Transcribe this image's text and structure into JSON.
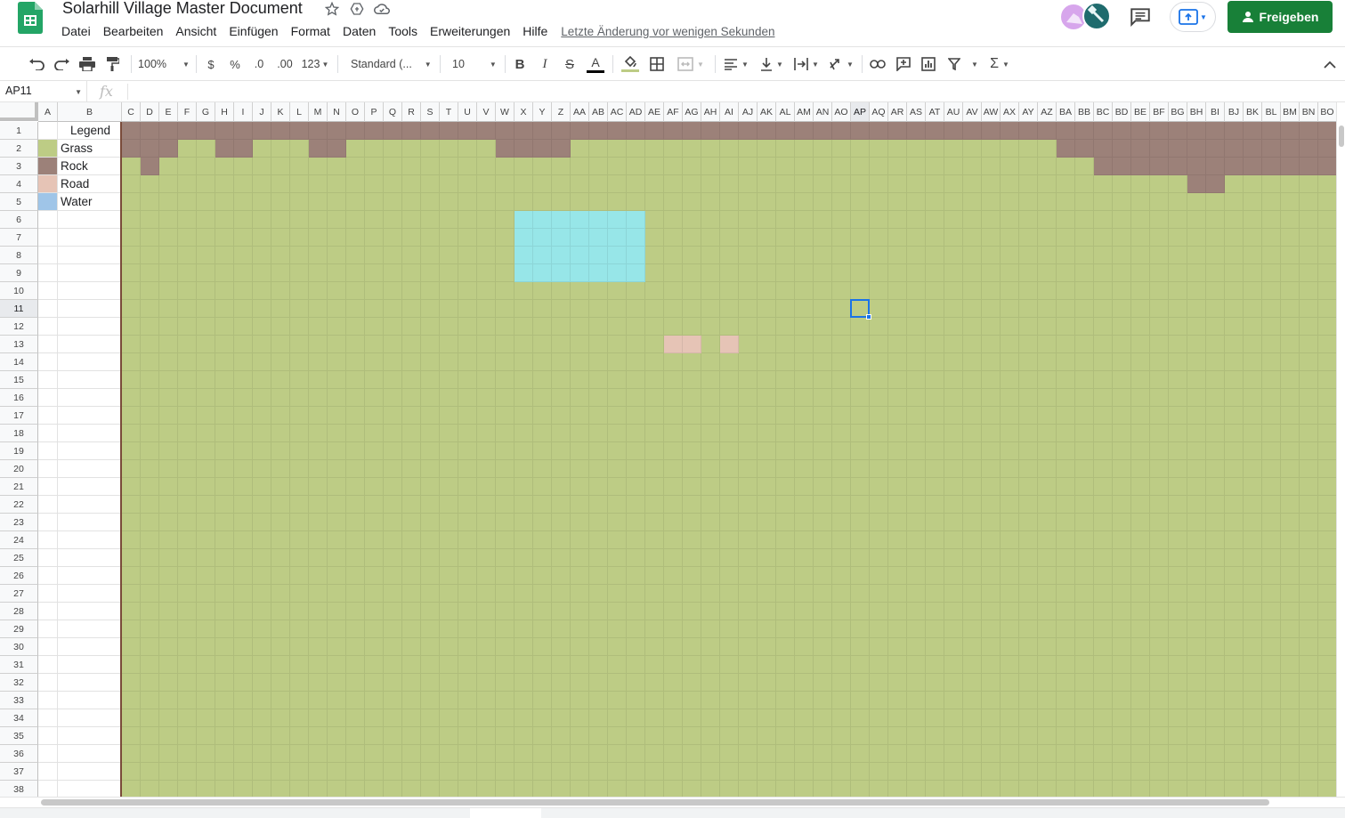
{
  "app": {
    "title": "Solarhill Village Master Document",
    "menu": [
      "Datei",
      "Bearbeiten",
      "Ansicht",
      "Einfügen",
      "Format",
      "Daten",
      "Tools",
      "Erweiterungen",
      "Hilfe"
    ],
    "last_edit": "Letzte Änderung vor wenigen Sekunden",
    "share_label": "Freigeben",
    "brand_color": "#188038"
  },
  "toolbar": {
    "zoom": "100%",
    "currency": "$",
    "percent": "%",
    "decimal_decrease": ".0",
    "decimal_increase": ".00",
    "more_formats": "123",
    "font": "Standard (...",
    "font_size": "10"
  },
  "formula_bar": {
    "name_box": "AP11",
    "fx": "fx",
    "value": ""
  },
  "sheet": {
    "columns": [
      "A",
      "B",
      "C",
      "D",
      "E",
      "F",
      "G",
      "H",
      "I",
      "J",
      "K",
      "L",
      "M",
      "N",
      "O",
      "P",
      "Q",
      "R",
      "S",
      "T",
      "U",
      "V",
      "W",
      "X",
      "Y",
      "Z",
      "AA",
      "AB",
      "AC",
      "AD",
      "AE",
      "AF",
      "AG",
      "AH",
      "AI",
      "AJ",
      "AK",
      "AL",
      "AM",
      "AN",
      "AO",
      "AP",
      "AQ",
      "AR",
      "AS",
      "AT",
      "AU",
      "AV",
      "AW",
      "AX",
      "AY",
      "AZ",
      "BA",
      "BB",
      "BC",
      "BD",
      "BE",
      "BF",
      "BG",
      "BH",
      "BI",
      "BJ",
      "BK",
      "BL",
      "BM",
      "BN",
      "BO"
    ],
    "rows": [
      "1",
      "2",
      "3",
      "4",
      "5",
      "6",
      "7",
      "8",
      "9",
      "10",
      "11",
      "12",
      "13",
      "14",
      "15",
      "16",
      "17",
      "18",
      "19",
      "20",
      "21",
      "22",
      "23",
      "24",
      "25",
      "26",
      "27",
      "28",
      "29",
      "30",
      "31",
      "32",
      "33",
      "34",
      "35",
      "36",
      "37",
      "38"
    ],
    "selected_cell": "AP11",
    "legend": {
      "title": "Legend",
      "items": [
        {
          "label": "Grass",
          "color": "#bdcc85"
        },
        {
          "label": "Rock",
          "color": "#9c8179"
        },
        {
          "label": "Road",
          "color": "#e6c4b6"
        },
        {
          "label": "Water",
          "color": "#9fc5e8"
        }
      ]
    },
    "map_colors": {
      "grass": "#bdcc85",
      "rock": "#9c8179",
      "road": "#e6c4b6",
      "water": "#97e6e8"
    },
    "rock_cells": {
      "1": [
        "C:BO"
      ],
      "2": [
        "C:E",
        "H:I",
        "M:N",
        "W:Z",
        "BA:BO"
      ],
      "3": [
        "D",
        "BC:BO"
      ],
      "4": [
        "BH:BI"
      ]
    },
    "water_cells": {
      "6": [
        "X:AD"
      ],
      "7": [
        "X:AD"
      ],
      "8": [
        "X:AD"
      ],
      "9": [
        "X:AD"
      ]
    },
    "road_cells": {
      "13": [
        "AF:AG",
        "AI"
      ]
    }
  }
}
